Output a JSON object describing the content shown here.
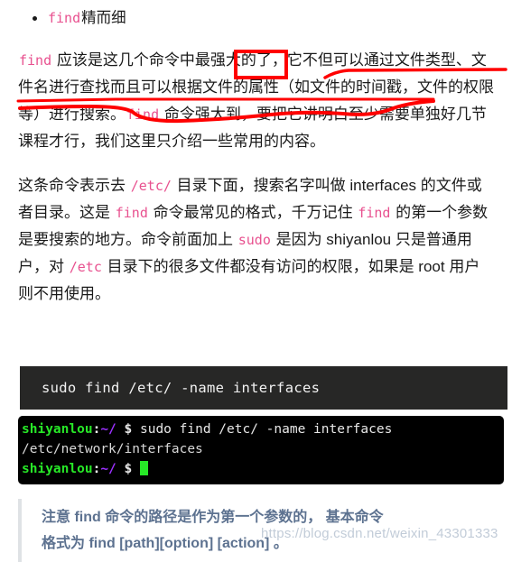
{
  "document": {
    "bullet_item": {
      "code": "find",
      "text": "精而细"
    },
    "paragraph_1": {
      "segments": [
        {
          "type": "code",
          "text": "find"
        },
        {
          "type": "text",
          "text": " 应该是这几个命令中最强大的了，它不但可以通过文件类型、文件名进行查找而且可以根据文件的属性（如文件的时间戳，文件的权限等）进行搜索。"
        },
        {
          "type": "code",
          "text": "find"
        },
        {
          "type": "text",
          "text": " 命令强大到，要把它讲明白至少需要单独好几节课程才行，我们这里只介绍一些常用的内容。"
        }
      ]
    },
    "paragraph_2": {
      "segments": [
        {
          "type": "text",
          "text": "这条命令表示去 "
        },
        {
          "type": "code",
          "text": "/etc/"
        },
        {
          "type": "text",
          "text": " 目录下面，搜索名字叫做 interfaces 的文件或者目录。这是 "
        },
        {
          "type": "code",
          "text": "find"
        },
        {
          "type": "text",
          "text": " 命令最常见的格式，千万记住 "
        },
        {
          "type": "code",
          "text": "find"
        },
        {
          "type": "text",
          "text": " 的第一个参数是要搜索的地方。命令前面加上 "
        },
        {
          "type": "code",
          "text": "sudo"
        },
        {
          "type": "text",
          "text": " 是因为 shiyanlou 只是普通用户，对 "
        },
        {
          "type": "code",
          "text": "/etc"
        },
        {
          "type": "text",
          "text": " 目录下的很多文件都没有访问的权限，如果是 root 用户则不用使用。"
        }
      ]
    },
    "code_block": {
      "command": "sudo find /etc/ -name interfaces"
    },
    "terminal": {
      "lines": [
        {
          "type": "prompt",
          "host": "shiyanlou",
          "colon": ":",
          "path": "~/",
          "dollar": " $ ",
          "command": "sudo find /etc/ -name interfaces"
        },
        {
          "type": "output",
          "text": "/etc/network/interfaces"
        },
        {
          "type": "prompt",
          "host": "shiyanlou",
          "colon": ":",
          "path": "~/",
          "dollar": " $ ",
          "command": ""
        }
      ]
    },
    "note": {
      "line_1": "注意 find 命令的路径是作为第一个参数的， 基本命令",
      "line_2": "格式为 find [path][option] [action] 。"
    },
    "watermark": {
      "text": "https://blog.csdn.net/weixin_43301333"
    },
    "annotations": {
      "highlight_word": "强大",
      "color": "#ff0000"
    },
    "colors": {
      "inline_code": "#e8518f",
      "body_text": "#1a1a1a",
      "code_block_bg": "#272726",
      "terminal_bg": "#000000",
      "terminal_prompt_green": "#27e827",
      "terminal_path_purple": "#9b30ff",
      "note_text": "#5d7290",
      "note_border": "#dfe2e5",
      "annotation_red": "#ff0000",
      "watermark": "#c2ccd8"
    }
  }
}
